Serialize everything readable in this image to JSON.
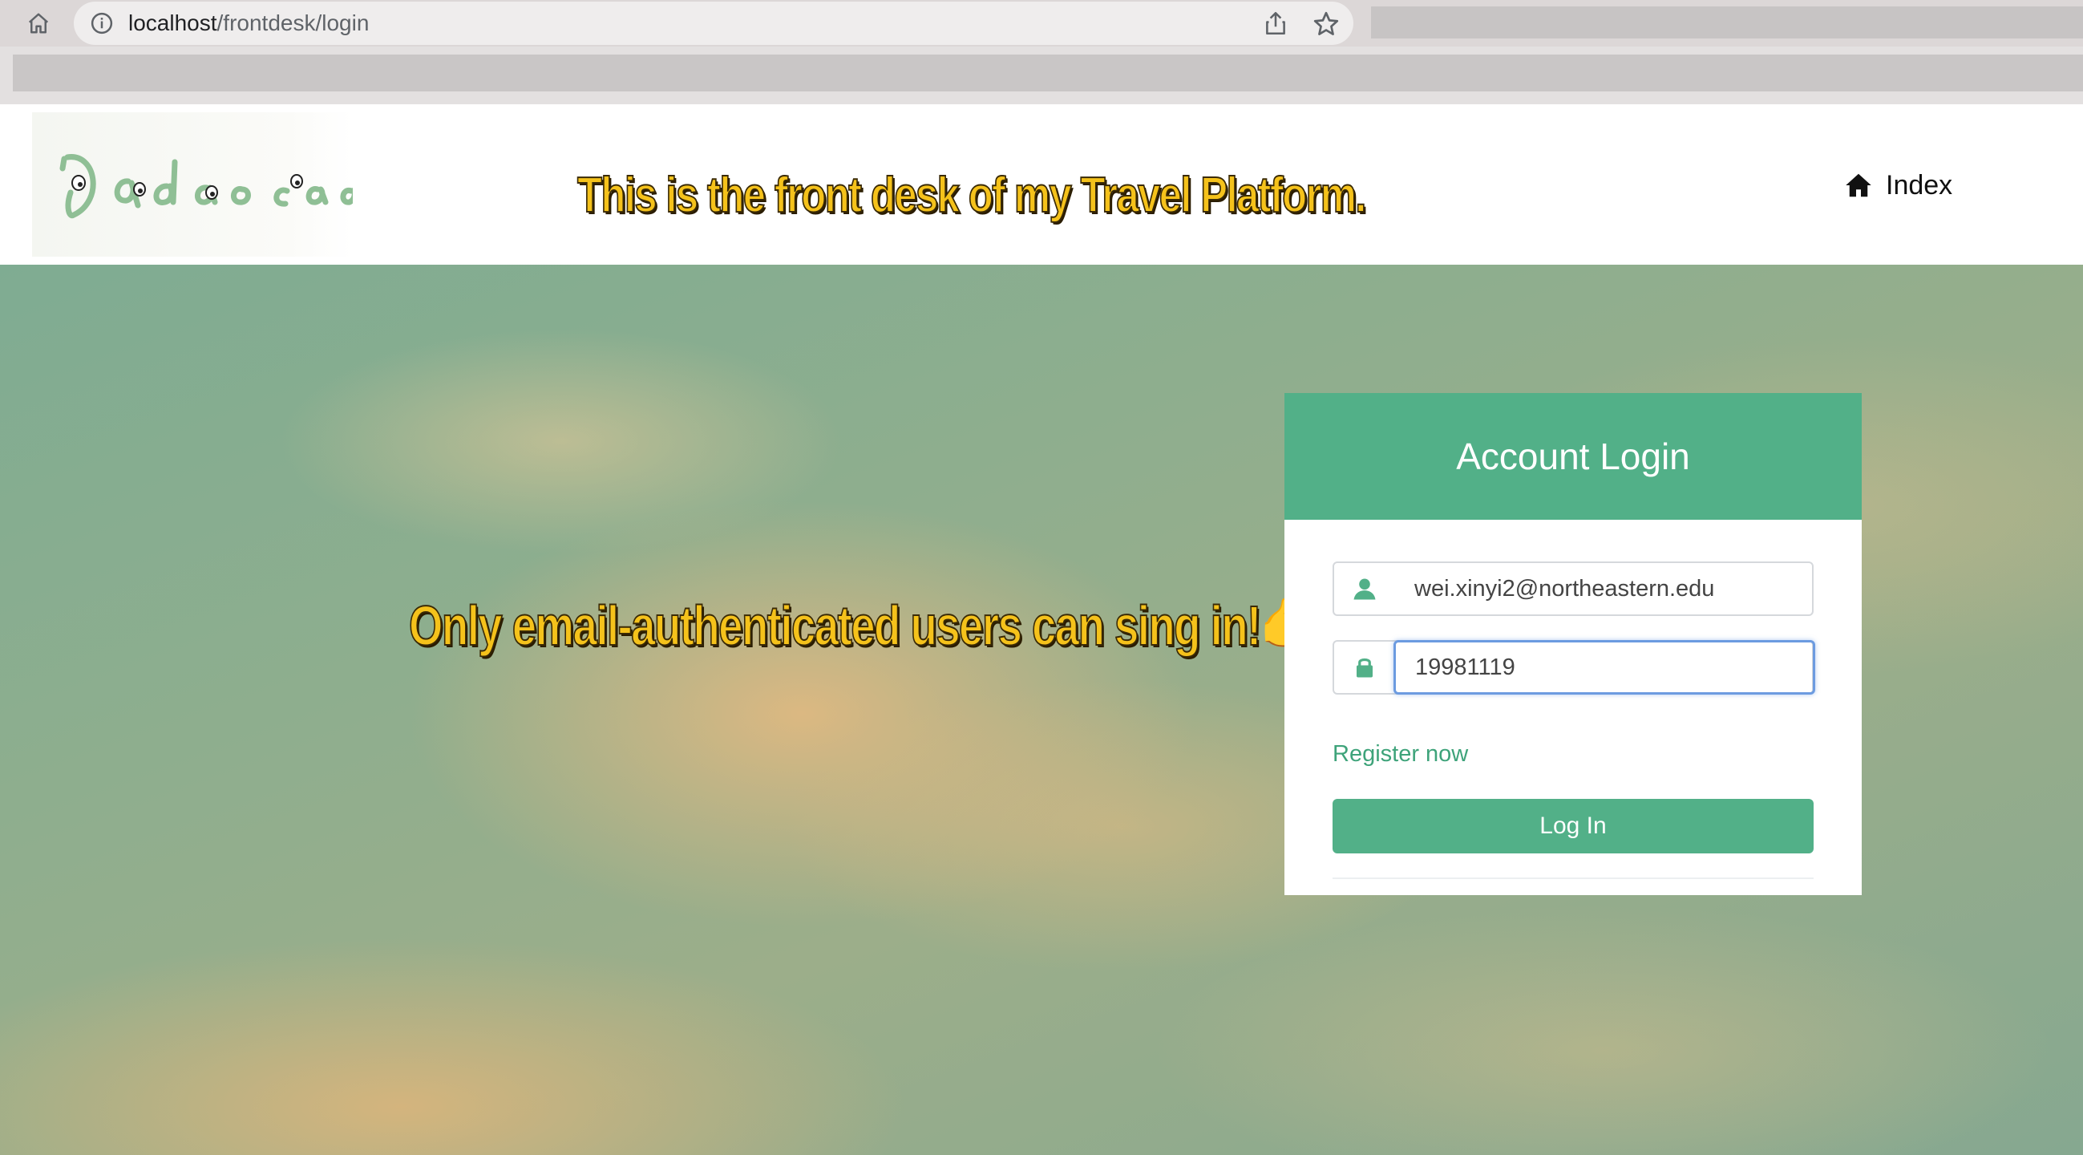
{
  "browser": {
    "url_host": "localhost",
    "url_path": "/frontdesk/login"
  },
  "header": {
    "logo_text": "Dadaocao",
    "headline": "This is the front desk of my Travel Platform.",
    "nav_index_label": "Index"
  },
  "hero": {
    "caption": "Only email-authenticated users can sing in!",
    "caption_emoji": "👉"
  },
  "login": {
    "title": "Account Login",
    "email_value": "wei.xinyi2@northeastern.edu",
    "password_value": "19981119",
    "register_label": "Register now",
    "login_button_label": "Log In"
  },
  "colors": {
    "accent": "#52b088",
    "link": "#3ea37a",
    "headline_yellow": "#f5c21b"
  },
  "icons": [
    "home-icon",
    "info-icon",
    "share-icon",
    "star-icon",
    "house-icon",
    "user-icon",
    "lock-icon"
  ]
}
